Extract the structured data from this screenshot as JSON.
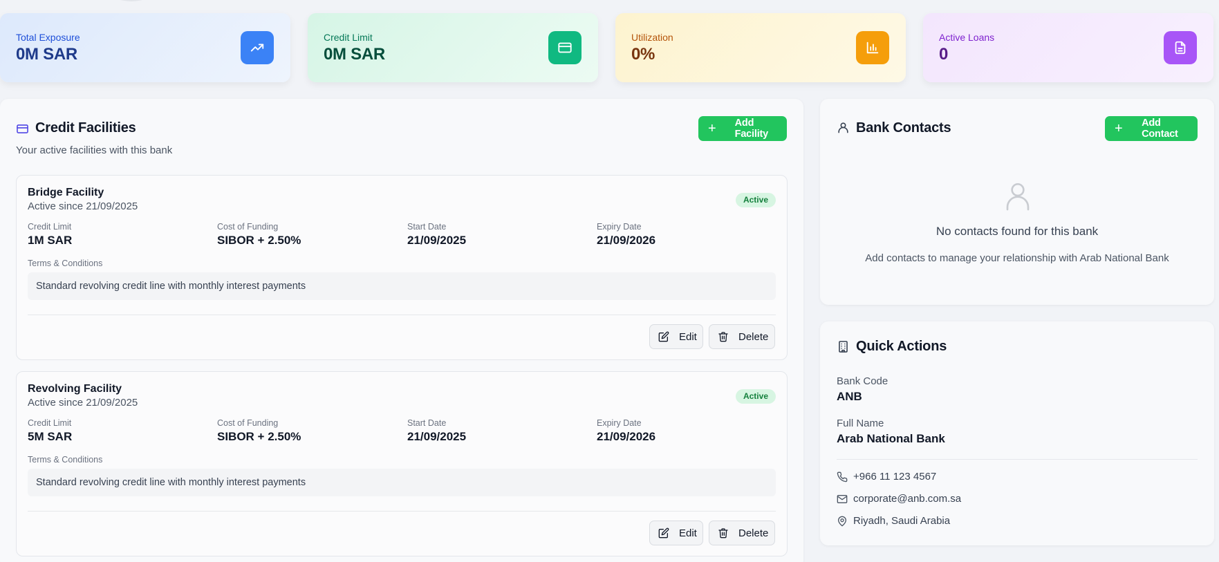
{
  "stats": [
    {
      "label": "Total Exposure",
      "value": "0M SAR",
      "icon": "trending-up-icon"
    },
    {
      "label": "Credit Limit",
      "value": "0M SAR",
      "icon": "credit-card-icon"
    },
    {
      "label": "Utilization",
      "value": "0%",
      "icon": "bar-chart-icon"
    },
    {
      "label": "Active Loans",
      "value": "0",
      "icon": "document-icon"
    }
  ],
  "facilities": {
    "title": "Credit Facilities",
    "subtitle": "Your active facilities with this bank",
    "add_label": "Add Facility",
    "field_labels": {
      "credit_limit": "Credit Limit",
      "cost_of_funding": "Cost of Funding",
      "start_date": "Start Date",
      "expiry_date": "Expiry Date",
      "terms": "Terms & Conditions"
    },
    "edit_label": "Edit",
    "delete_label": "Delete",
    "items": [
      {
        "name": "Bridge Facility",
        "since": "Active since 21/09/2025",
        "status": "Active",
        "credit_limit": "1M SAR",
        "cost_of_funding": "SIBOR + 2.50%",
        "start_date": "21/09/2025",
        "expiry_date": "21/09/2026",
        "terms": "Standard revolving credit line with monthly interest payments"
      },
      {
        "name": "Revolving Facility",
        "since": "Active since 21/09/2025",
        "status": "Active",
        "credit_limit": "5M SAR",
        "cost_of_funding": "SIBOR + 2.50%",
        "start_date": "21/09/2025",
        "expiry_date": "21/09/2026",
        "terms": "Standard revolving credit line with monthly interest payments"
      }
    ]
  },
  "contacts": {
    "title": "Bank Contacts",
    "add_label": "Add Contact",
    "empty_title": "No contacts found for this bank",
    "empty_subtitle": "Add contacts to manage your relationship with Arab National Bank"
  },
  "quick_actions": {
    "title": "Quick Actions",
    "bank_code_label": "Bank Code",
    "bank_code": "ANB",
    "full_name_label": "Full Name",
    "full_name": "Arab National Bank",
    "phone": "+966 11 123 4567",
    "email": "corporate@anb.com.sa",
    "location": "Riyadh, Saudi Arabia"
  },
  "colors": {
    "accent_green": "#22c55e",
    "blue": "#3b82f6",
    "emerald": "#10b981",
    "amber": "#f59e0b",
    "purple": "#a855f7"
  }
}
